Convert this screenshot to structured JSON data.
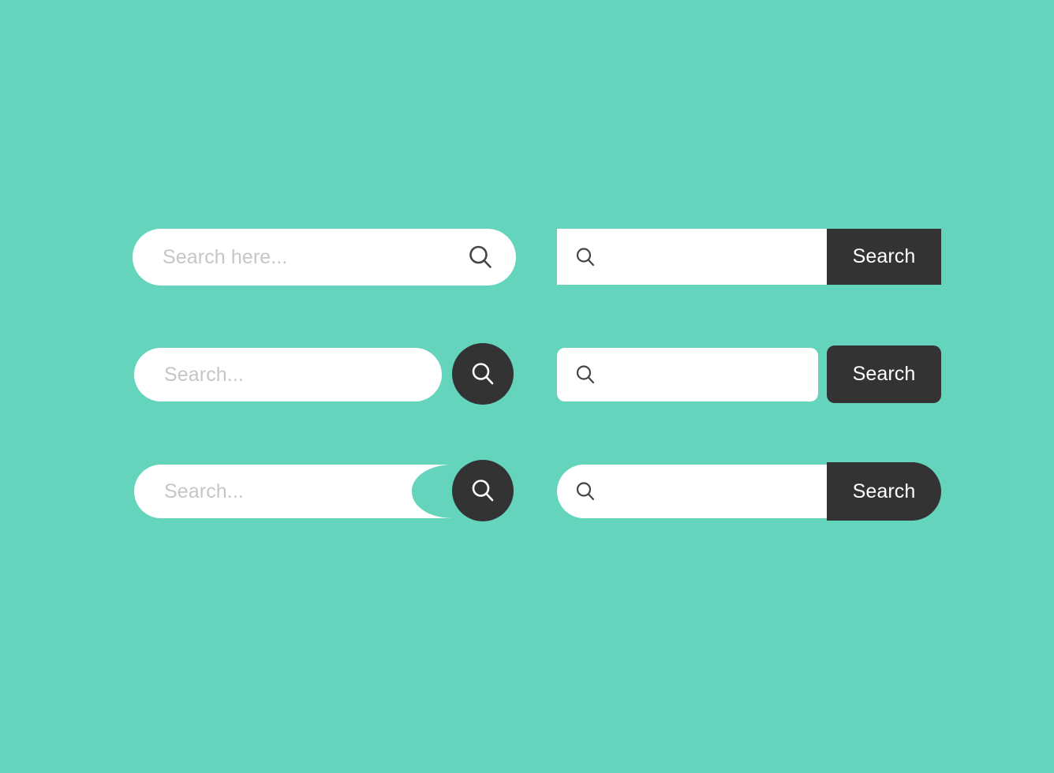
{
  "page": {
    "title": "Search Bar UI Kit",
    "background_color": "#64d5bc",
    "dark_color": "#333333",
    "field_color": "#ffffff",
    "placeholder_color": "#c6c6c6",
    "icon_dark_color": "#444444",
    "icon_light_color": "#ffffff"
  },
  "search_bars": [
    {
      "id": "bar-1",
      "variant": "pill-inline-icon",
      "placeholder": "Search here...",
      "icon": "magnifier-icon",
      "icon_tone": "dark",
      "button_label": null
    },
    {
      "id": "bar-2",
      "variant": "square-attached-button",
      "placeholder": "",
      "icon": "magnifier-icon",
      "icon_tone": "dark",
      "button_label": "Search"
    },
    {
      "id": "bar-3",
      "variant": "pill-circle-button",
      "placeholder": "Search...",
      "icon": "magnifier-icon",
      "icon_tone": "light",
      "button_label": null
    },
    {
      "id": "bar-4",
      "variant": "rounded-detached-button",
      "placeholder": "",
      "icon": "magnifier-icon",
      "icon_tone": "dark",
      "button_label": "Search"
    },
    {
      "id": "bar-5",
      "variant": "notched-pill-circle-button",
      "placeholder": "Search...",
      "icon": "magnifier-icon",
      "icon_tone": "light",
      "button_label": null
    },
    {
      "id": "bar-6",
      "variant": "pill-attached-button",
      "placeholder": "",
      "icon": "magnifier-icon",
      "icon_tone": "dark",
      "button_label": "Search"
    }
  ]
}
